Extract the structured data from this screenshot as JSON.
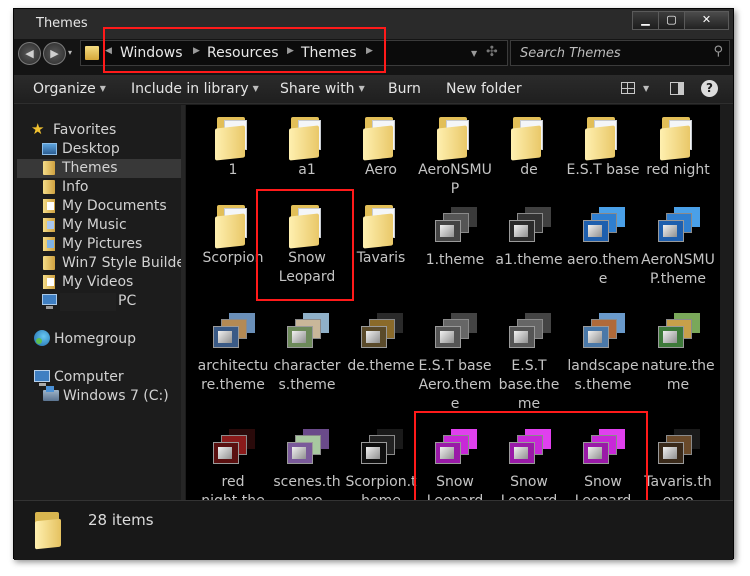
{
  "window": {
    "title": "Themes"
  },
  "window_controls": {
    "minimize": "▁",
    "maximize": "▢",
    "close": "✕"
  },
  "nav_buttons": {
    "back": "◀",
    "forward": "▶",
    "dropdown": "▾"
  },
  "address_bar": {
    "crumbs": [
      "Windows",
      "Resources",
      "Themes"
    ]
  },
  "search": {
    "placeholder": "Search Themes"
  },
  "toolbar": {
    "organize": "Organize",
    "include_in_library": "Include in library",
    "share_with": "Share with",
    "burn": "Burn",
    "new_folder": "New folder",
    "help": "?"
  },
  "nav_pane": {
    "favorites": "Favorites",
    "desktop": "Desktop",
    "themes": "Themes",
    "info": "Info",
    "my_documents": "My Documents",
    "my_music": "My Music",
    "my_pictures": "My Pictures",
    "win7_style_builder": "Win7 Style Builder",
    "my_videos": "My Videos",
    "pc_suffix": "PC",
    "homegroup": "Homegroup",
    "computer": "Computer",
    "drive": "Windows 7 (C:)"
  },
  "items": [
    {
      "name": "1",
      "kind": "folder"
    },
    {
      "name": "a1",
      "kind": "folder"
    },
    {
      "name": "Aero",
      "kind": "folder"
    },
    {
      "name": "AeroNSMUP",
      "kind": "folder"
    },
    {
      "name": "de",
      "kind": "folder"
    },
    {
      "name": "E.S.T base",
      "kind": "folder"
    },
    {
      "name": "red night",
      "kind": "folder"
    },
    {
      "name": "Scorpion",
      "kind": "folder"
    },
    {
      "name": "Snow Leopard",
      "kind": "folder"
    },
    {
      "name": "Tavaris",
      "kind": "folder"
    },
    {
      "name": "1.theme",
      "kind": "theme"
    },
    {
      "name": "a1.theme",
      "kind": "theme"
    },
    {
      "name": "aero.theme",
      "kind": "theme"
    },
    {
      "name": "AeroNSMUP.theme",
      "kind": "theme"
    },
    {
      "name": "architecture.theme",
      "kind": "theme"
    },
    {
      "name": "characters.theme",
      "kind": "theme"
    },
    {
      "name": "de.theme",
      "kind": "theme"
    },
    {
      "name": "E.S.T base Aero.theme",
      "kind": "theme"
    },
    {
      "name": "E.S.T base.theme",
      "kind": "theme"
    },
    {
      "name": "landscapes.theme",
      "kind": "theme"
    },
    {
      "name": "nature.theme",
      "kind": "theme"
    },
    {
      "name": "red night.theme",
      "kind": "theme"
    },
    {
      "name": "scenes.theme",
      "kind": "theme"
    },
    {
      "name": "Scorpion.theme",
      "kind": "theme"
    },
    {
      "name": "Snow Leopard Basic.th",
      "kind": "theme"
    },
    {
      "name": "Snow Leopard Glass.th",
      "kind": "theme"
    },
    {
      "name": "Snow Leopard .theme",
      "kind": "theme"
    },
    {
      "name": "Tavaris.theme",
      "kind": "theme"
    }
  ],
  "details": {
    "count": "28 items"
  },
  "colors": {
    "highlight_box": "#ff1a1a",
    "content_bg": "#000000",
    "chrome_bg": "#1c1c1c",
    "selected_nav_bg": "#383838"
  }
}
